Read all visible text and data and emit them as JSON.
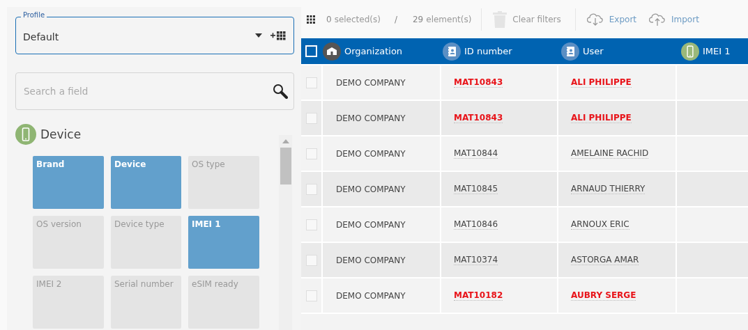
{
  "profile": {
    "label": "Profile",
    "value": "Default"
  },
  "search": {
    "placeholder": "Search a field"
  },
  "section": {
    "title": "Device"
  },
  "fields": [
    {
      "label": "Brand",
      "selected": true
    },
    {
      "label": "Device",
      "selected": true
    },
    {
      "label": "OS type",
      "selected": false
    },
    {
      "label": "OS version",
      "selected": false
    },
    {
      "label": "Device type",
      "selected": false
    },
    {
      "label": "IMEI 1",
      "selected": true
    },
    {
      "label": "IMEI 2",
      "selected": false
    },
    {
      "label": "Serial number",
      "selected": false
    },
    {
      "label": "eSIM ready",
      "selected": false
    }
  ],
  "toolbar": {
    "selected_count": "0",
    "selected_label": "selected(s)",
    "separator": "/",
    "total_count": "29",
    "total_label": "element(s)",
    "clear": "Clear filters",
    "export": "Export",
    "import": "Import"
  },
  "table": {
    "select_all": false,
    "columns": [
      {
        "label": "Organization",
        "kind": "org"
      },
      {
        "label": "ID number",
        "kind": "contact"
      },
      {
        "label": "User",
        "kind": "contact"
      },
      {
        "label": "IMEI 1",
        "kind": "phone"
      }
    ],
    "rows": [
      {
        "checked": false,
        "flagged": true,
        "cells": [
          "DEMO COMPANY",
          "MAT10843",
          "ALI PHILIPPE",
          ""
        ]
      },
      {
        "checked": false,
        "flagged": true,
        "cells": [
          "DEMO COMPANY",
          "MAT10843",
          "ALI PHILIPPE",
          ""
        ]
      },
      {
        "checked": false,
        "flagged": false,
        "cells": [
          "DEMO COMPANY",
          "MAT10844",
          "AMELAINE RACHID",
          ""
        ]
      },
      {
        "checked": false,
        "flagged": false,
        "cells": [
          "DEMO COMPANY",
          "MAT10845",
          "ARNAUD THIERRY",
          ""
        ]
      },
      {
        "checked": false,
        "flagged": false,
        "cells": [
          "DEMO COMPANY",
          "MAT10846",
          "ARNOUX ERIC",
          ""
        ]
      },
      {
        "checked": false,
        "flagged": false,
        "cells": [
          "DEMO COMPANY",
          "MAT10374",
          "ASTORGA AMAR",
          ""
        ]
      },
      {
        "checked": false,
        "flagged": true,
        "cells": [
          "DEMO COMPANY",
          "MAT10182",
          "AUBRY SERGE",
          ""
        ]
      }
    ]
  }
}
